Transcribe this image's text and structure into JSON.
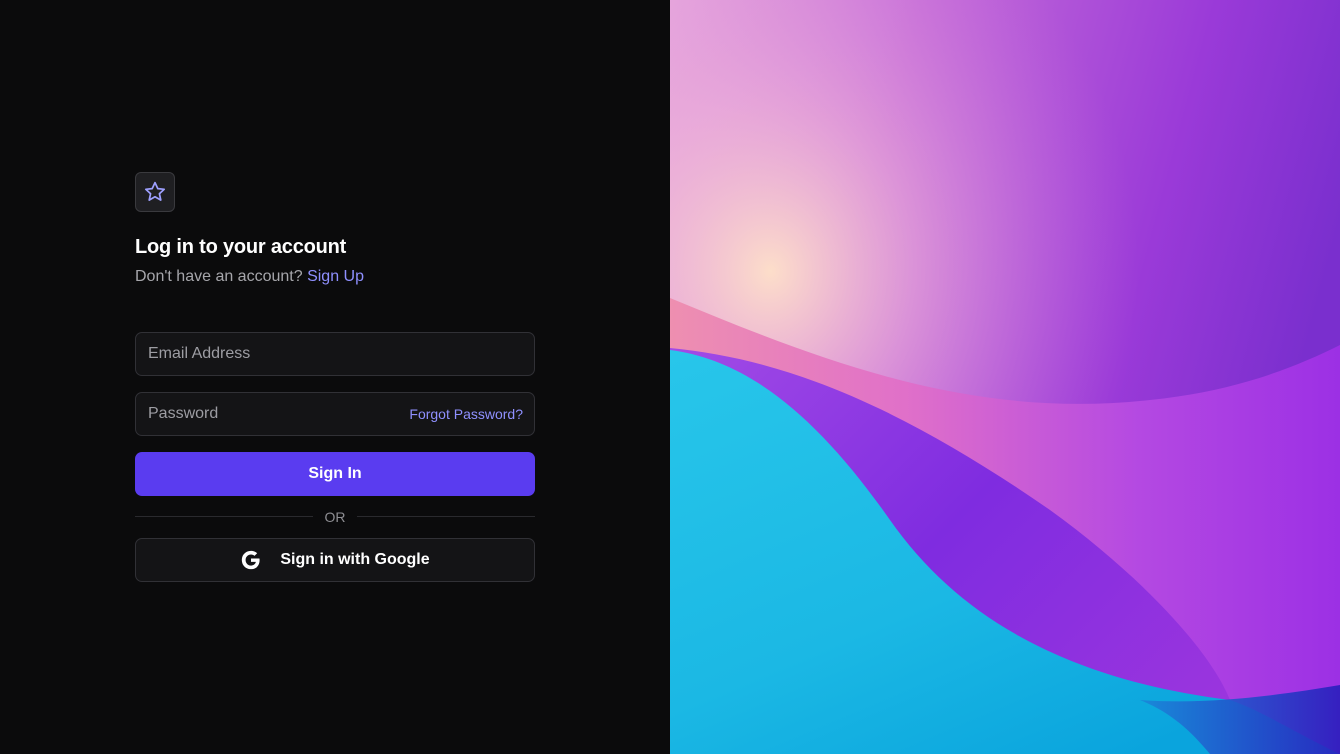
{
  "login": {
    "title": "Log in to your account",
    "subtitle_prefix": "Don't have an account?",
    "signup_link": "Sign Up",
    "email_placeholder": "Email Address",
    "password_placeholder": "Password",
    "forgot_link": "Forgot Password?",
    "signin_button": "Sign In",
    "divider_text": "OR",
    "google_button": "Sign in with Google"
  },
  "icons": {
    "logo": "star-icon",
    "google": "google-icon"
  },
  "colors": {
    "accent": "#5a3cf0",
    "link": "#8f90ff",
    "background": "#0b0b0c"
  }
}
